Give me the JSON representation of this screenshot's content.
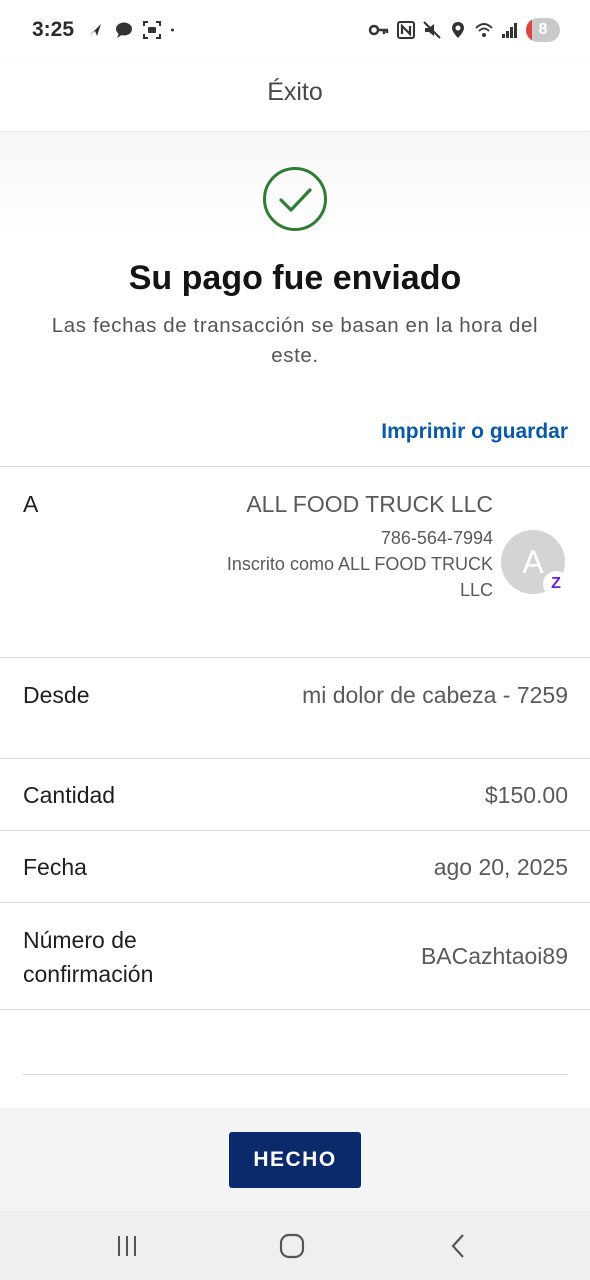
{
  "status_bar": {
    "time": "3:25",
    "battery_level": "8",
    "left_icons": [
      "navigation-icon",
      "chat-icon",
      "screenshot-icon",
      "dot-icon"
    ],
    "right_icons": [
      "key-icon",
      "nfc-icon",
      "mute-icon",
      "location-icon",
      "wifi-icon",
      "signal-icon",
      "battery-icon"
    ]
  },
  "header": {
    "title": "Éxito"
  },
  "success": {
    "icon": "check-circle-icon",
    "title": "Su pago fue enviado",
    "subtitle": "Las fechas de transacción se basan en la hora del este.",
    "print_link": "Imprimir o guardar"
  },
  "details": {
    "to": {
      "label": "A",
      "name": "ALL FOOD TRUCK LLC",
      "phone": "786-564-7994",
      "enrolled": "Inscrito como ALL FOOD TRUCK LLC",
      "avatar_letter": "A",
      "badge": "Z"
    },
    "from": {
      "label": "Desde",
      "value": "mi dolor de cabeza - 7259"
    },
    "amount": {
      "label": "Cantidad",
      "value": "$150.00"
    },
    "date": {
      "label": "Fecha",
      "value": "ago 20, 2025"
    },
    "confirmation": {
      "label": "Número de confirmación",
      "value": "BACazhtaoi89"
    }
  },
  "footer": {
    "done_label": "HECHO"
  },
  "colors": {
    "accent": "#0a5aa8",
    "button": "#0b2a6b",
    "success": "#2e7d32",
    "zelle": "#6d1ed4"
  }
}
